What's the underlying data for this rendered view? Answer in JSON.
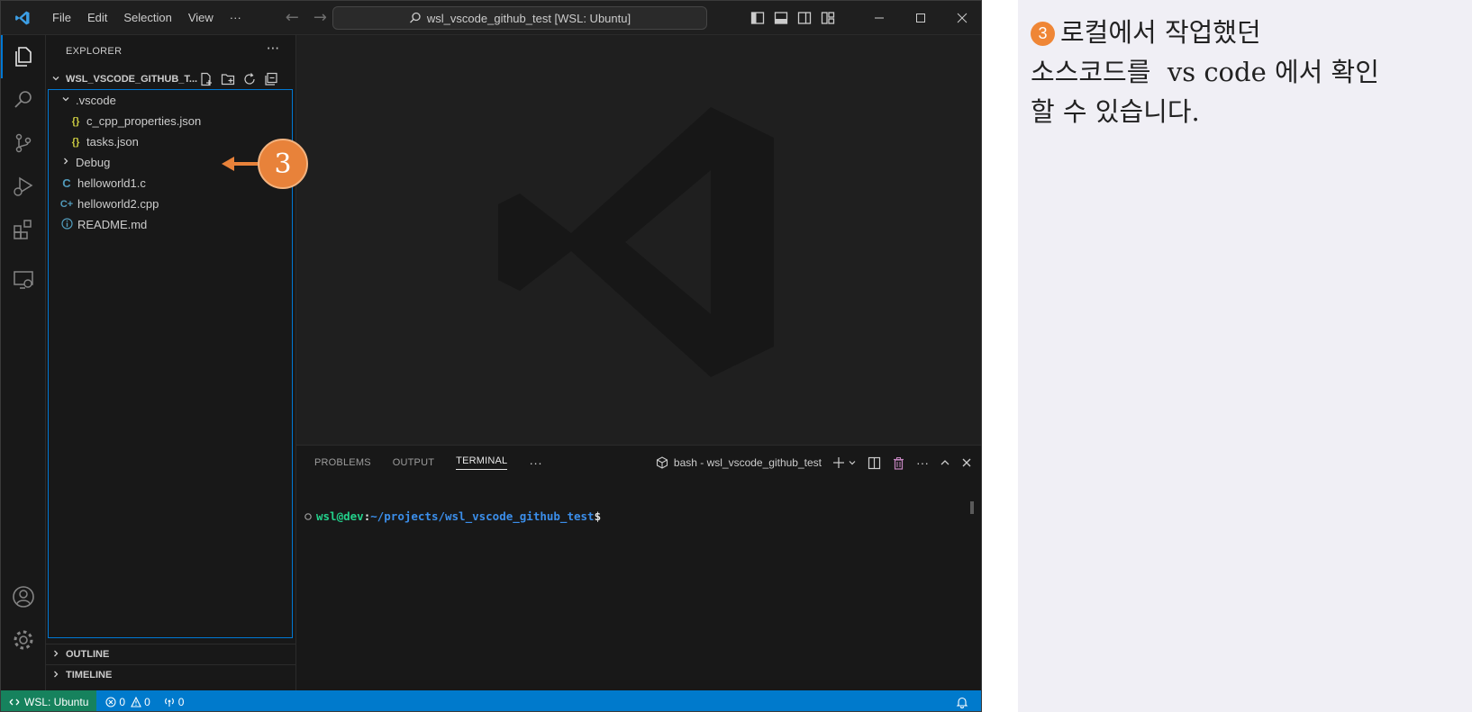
{
  "titlebar": {
    "menu": [
      "File",
      "Edit",
      "Selection",
      "View",
      "···"
    ],
    "command_center": "wsl_vscode_github_test [WSL: Ubuntu]"
  },
  "sidebar": {
    "title": "EXPLORER",
    "more": "···",
    "folder_name": "WSL_VSCODE_GITHUB_T...",
    "tree": [
      {
        "label": ".vscode",
        "kind": "folder-open",
        "indent": 1
      },
      {
        "label": "c_cpp_properties.json",
        "kind": "json",
        "indent": 2
      },
      {
        "label": "tasks.json",
        "kind": "json",
        "indent": 2
      },
      {
        "label": "Debug",
        "kind": "folder-closed",
        "indent": 1
      },
      {
        "label": "helloworld1.c",
        "kind": "c",
        "indent": 1
      },
      {
        "label": "helloworld2.cpp",
        "kind": "cpp",
        "indent": 1
      },
      {
        "label": "README.md",
        "kind": "info",
        "indent": 1
      }
    ],
    "outline_label": "OUTLINE",
    "timeline_label": "TIMELINE"
  },
  "panel": {
    "tabs": [
      "PROBLEMS",
      "OUTPUT",
      "TERMINAL"
    ],
    "active_tab": "TERMINAL",
    "more": "···",
    "terminal_name": "bash - wsl_vscode_github_test",
    "prompt_user": "wsl@dev",
    "prompt_sep": ":",
    "prompt_path": "~/projects/wsl_vscode_github_test",
    "prompt_dollar": "$"
  },
  "statusbar": {
    "remote": "WSL: Ubuntu",
    "errors": "0",
    "warnings": "0",
    "ports": "0"
  },
  "callout": {
    "number": "3"
  },
  "note": {
    "number": "3",
    "line1": "로컬에서 작업했던",
    "line2": "소스코드를  vs code 에서 확인",
    "line3": "할 수 있습니다."
  },
  "colors": {
    "accent": "#0078d4",
    "statusbar": "#007acc",
    "remote": "#16825d",
    "callout": "#e8823a",
    "terminal_user": "#23d18b",
    "terminal_path": "#3b8eea"
  }
}
